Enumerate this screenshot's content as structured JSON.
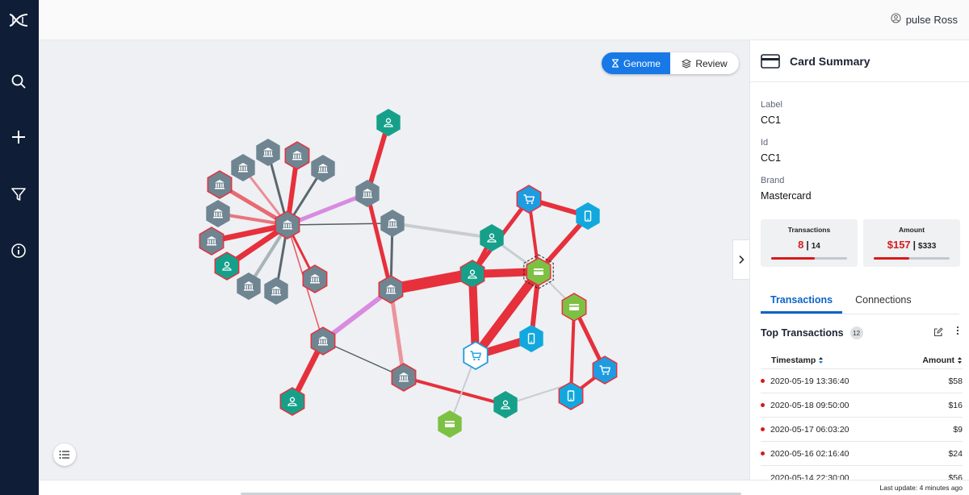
{
  "user": {
    "name": "pulse Ross"
  },
  "toolbar": {
    "genome_label": "Genome",
    "review_label": "Review"
  },
  "panel": {
    "title": "Card Summary",
    "fields": [
      {
        "label": "Label",
        "value": "CC1"
      },
      {
        "label": "Id",
        "value": "CC1"
      },
      {
        "label": "Brand",
        "value": "Mastercard"
      }
    ],
    "stats": {
      "transactions": {
        "title": "Transactions",
        "value": "8",
        "total": "14",
        "fraction": 0.57
      },
      "amount": {
        "title": "Amount",
        "value": "$157",
        "total": "$333",
        "fraction": 0.47
      }
    },
    "tabs": [
      {
        "label": "Transactions"
      },
      {
        "label": "Connections"
      }
    ],
    "top_transactions": {
      "title": "Top Transactions",
      "count": "12",
      "columns": {
        "timestamp": "Timestamp",
        "amount": "Amount"
      },
      "rows": [
        {
          "timestamp": "2020-05-19 13:36:40",
          "amount": "$58"
        },
        {
          "timestamp": "2020-05-18 09:50:00",
          "amount": "$16"
        },
        {
          "timestamp": "2020-05-17 06:03:20",
          "amount": "$9"
        },
        {
          "timestamp": "2020-05-16 02:16:40",
          "amount": "$24"
        },
        {
          "timestamp": "2020-05-14 22:30:00",
          "amount": "$56"
        }
      ]
    }
  },
  "footer": {
    "last_update": "Last update: 4 minutes ago"
  },
  "colors": {
    "rail": "#0f1e36",
    "accent": "#1878e6",
    "danger": "#d81a1a",
    "bank_node": "#6f8591",
    "person_node": "#16a08a",
    "card_node": "#7dc144",
    "device_node": "#13a8dd",
    "merchant_node": "#1f9be0"
  },
  "graph_icons": [
    "bank-icon",
    "person-icon",
    "credit-card-icon",
    "phone-icon",
    "shopping-cart-icon"
  ]
}
